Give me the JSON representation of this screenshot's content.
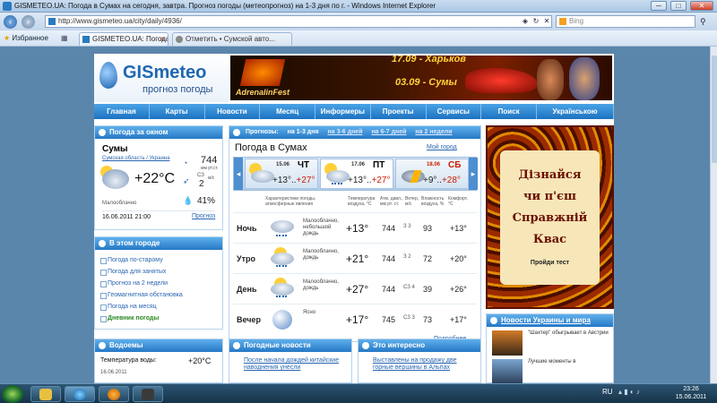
{
  "window": {
    "title": "GISMETEO.UA: Погода в Сумах на сегодня, завтра. Прогноз погоды (метеопрогноз) на 1-3 дня по г. - Windows Internet Explorer",
    "controls": [
      "─",
      "□",
      "✕"
    ]
  },
  "address": {
    "url": "http://www.gismeteo.ua/city/daily/4936/",
    "search_value": "Bing"
  },
  "favorites": {
    "label": "Избранное",
    "tabs": [
      {
        "label": "GISMETEO.UA: Погода в Сумах на..."
      },
      {
        "label": "Отметить • Сумской авто..."
      }
    ]
  },
  "site": {
    "logo_text": "GISmeteo",
    "logo_sub": "прогноз погоды",
    "banner": {
      "line1": "17.09 - Харьков",
      "line2": "03.09 - Сумы",
      "brand": "AdrenalinFest"
    },
    "menu": [
      "Главная",
      "Карты",
      "Новости",
      "Месяц",
      "Информеры",
      "Проекты",
      "Сервисы",
      "Поиск",
      "Українською"
    ]
  },
  "now": {
    "header": "Погода за окном",
    "city": "Сумы",
    "region": "Сумская область / Украина",
    "temp": "+22°C",
    "pressure": "744",
    "pressure_unit": "мм рт.ст.",
    "wind_dir": "СЗ",
    "wind": "2",
    "wind_unit": "м/с",
    "humidity": "41%",
    "desc": "Малооблачно",
    "date": "16.06.2011 21:00",
    "forecast_link": "Прогноз"
  },
  "city_box": {
    "header": "В этом городе",
    "items": [
      {
        "label": "Погода по-старому",
        "green": false
      },
      {
        "label": "Погода для занятых",
        "green": false
      },
      {
        "label": "Прогноз на 2 недели",
        "green": false
      },
      {
        "label": "Геомагнитная обстановка",
        "green": false
      },
      {
        "label": "Погода на месяц",
        "green": false
      },
      {
        "label": "Дневник погоды",
        "green": true
      }
    ]
  },
  "forecast": {
    "tab_label": "Прогнозы:",
    "tabs": [
      "на 1-3 дня",
      "на 3-6 дней",
      "на 6-7 дней",
      "на 2 недели"
    ],
    "title": "Погода в Сумах",
    "my_city": "Мой город",
    "days": [
      {
        "date": "15.06",
        "dow": "ЧТ",
        "low": "+13°",
        "high": "+27°",
        "red": false,
        "icon": "partly-cloudy"
      },
      {
        "date": "17.06",
        "dow": "ПТ",
        "low": "+13°",
        "high": "+27°",
        "red": false,
        "icon": "partly-cloudy-rain"
      },
      {
        "date": "18.06",
        "dow": "СБ",
        "low": "+9°",
        "high": "+28°",
        "red": true,
        "icon": "thunder"
      }
    ],
    "columns": {
      "phen": "Характеристики погоды, атмосферные явления",
      "temp": "Температура воздуха, °C",
      "pressure": "Атм. давл., мм рт. ст.",
      "wind": "Ветер, м/с",
      "humidity": "Влажность воздуха, %",
      "comfort": "Комфорт, °C"
    },
    "rows": [
      {
        "period": "Ночь",
        "desc": "Малооблачно, небольшой дождь",
        "temp": "+13°",
        "pressure": "744",
        "wind": "З 3",
        "humidity": "93",
        "comfort": "+13°",
        "icon": "cloud-rain"
      },
      {
        "period": "Утро",
        "desc": "Малооблачно, дождь",
        "temp": "+21°",
        "pressure": "744",
        "wind": "З 2",
        "humidity": "72",
        "comfort": "+20°",
        "icon": "sun-cloud-rain"
      },
      {
        "period": "День",
        "desc": "Малооблачно, дождь",
        "temp": "+27°",
        "pressure": "744",
        "wind": "СЗ 4",
        "humidity": "39",
        "comfort": "+26°",
        "icon": "sun-cloud-rain"
      },
      {
        "period": "Вечер",
        "desc": "Ясно",
        "temp": "+17°",
        "pressure": "745",
        "wind": "СЗ 3",
        "humidity": "73",
        "comfort": "+17°",
        "icon": "moon"
      }
    ],
    "more": "Подробнее"
  },
  "ad": {
    "lines": [
      "Дізнайся",
      "чи п'єш",
      "Справжній",
      "Квас"
    ],
    "button": "Пройди тест"
  },
  "news_ua": {
    "header": "Новости Украины и мира",
    "items": [
      {
        "text": "\"Шахтер\" обыгрывает в Австрии"
      },
      {
        "text": "Лучшие моменты в"
      }
    ]
  },
  "water": {
    "header": "Водоемы",
    "label": "Температура воды:",
    "value": "+20°C",
    "date": "16.06.2011"
  },
  "weather_news": {
    "header": "Погодные новости",
    "item": "После начала дождей китайские наводнения унесли"
  },
  "interesting": {
    "header": "Это интересно",
    "item": "Выставлены на продажу две горные вершины в Альпах"
  },
  "taskbar": {
    "lang": "RU",
    "time": "23:26",
    "date": "15.06.2011"
  }
}
